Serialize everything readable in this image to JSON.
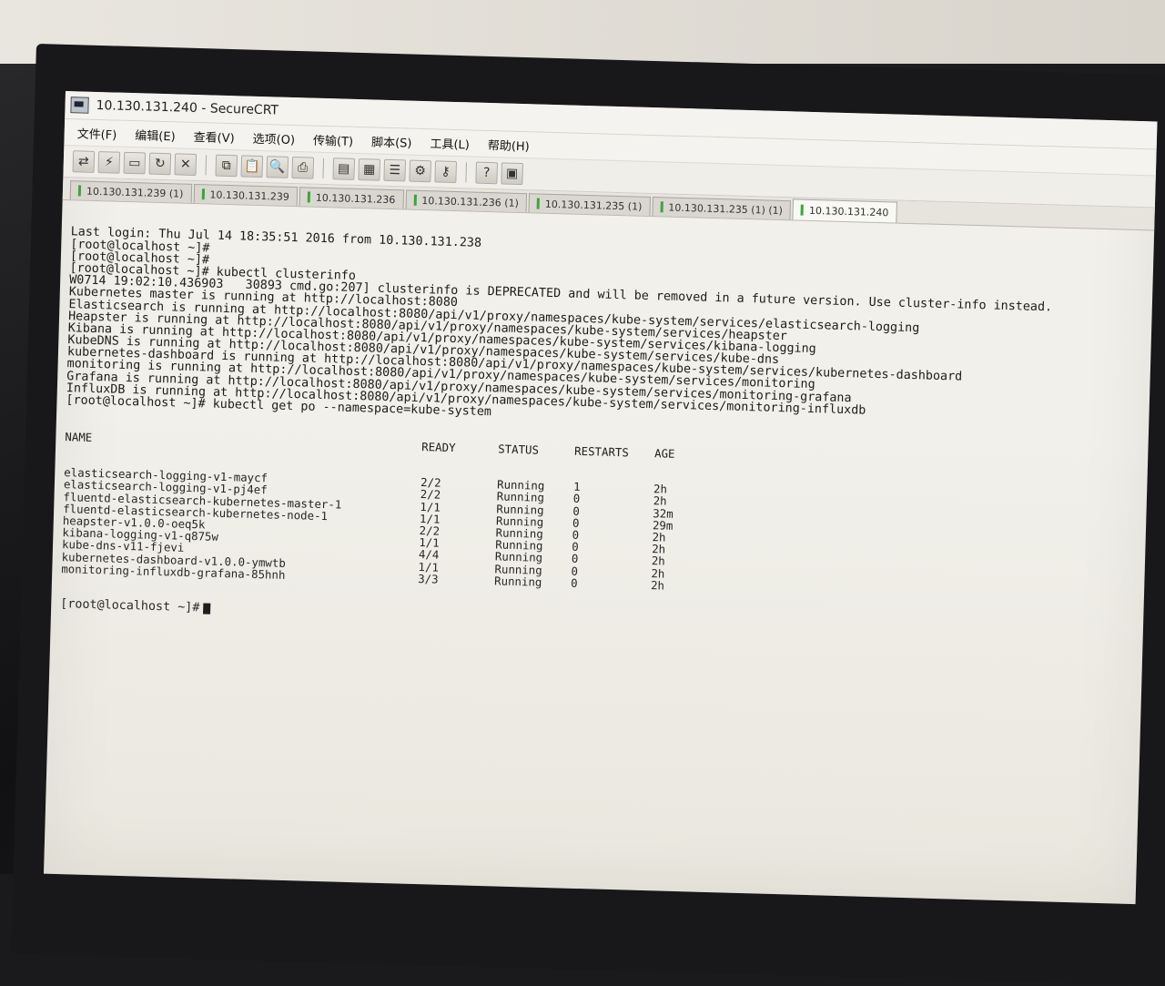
{
  "window": {
    "title": "10.130.131.240 - SecureCRT"
  },
  "menu": [
    {
      "label": "文件(F)"
    },
    {
      "label": "编辑(E)"
    },
    {
      "label": "查看(V)"
    },
    {
      "label": "选项(O)"
    },
    {
      "label": "传输(T)"
    },
    {
      "label": "脚本(S)"
    },
    {
      "label": "工具(L)"
    },
    {
      "label": "帮助(H)"
    }
  ],
  "toolbar": [
    {
      "icon": "connect-icon",
      "glyph": "⇄"
    },
    {
      "icon": "quick-connect-icon",
      "glyph": "⚡"
    },
    {
      "icon": "connect-tab-icon",
      "glyph": "▭"
    },
    {
      "icon": "reconnect-icon",
      "glyph": "↻"
    },
    {
      "icon": "disconnect-icon",
      "glyph": "✕"
    },
    {
      "icon": "copy-icon",
      "glyph": "⧉"
    },
    {
      "icon": "paste-icon",
      "glyph": "📋"
    },
    {
      "icon": "find-icon",
      "glyph": "🔍"
    },
    {
      "icon": "print-icon",
      "glyph": "⎙"
    },
    {
      "icon": "log-icon",
      "glyph": "▤"
    },
    {
      "icon": "print-screen-icon",
      "glyph": "▦"
    },
    {
      "icon": "session-options-icon",
      "glyph": "☰"
    },
    {
      "icon": "global-options-icon",
      "glyph": "⚙"
    },
    {
      "icon": "key-icon",
      "glyph": "⚷"
    },
    {
      "icon": "help-icon",
      "glyph": "?"
    },
    {
      "icon": "map-icon",
      "glyph": "▣"
    }
  ],
  "tabs": [
    {
      "label": "10.130.131.239 (1)",
      "active": false
    },
    {
      "label": "10.130.131.239",
      "active": false
    },
    {
      "label": "10.130.131.236",
      "active": false
    },
    {
      "label": "10.130.131.236 (1)",
      "active": false
    },
    {
      "label": "10.130.131.235 (1)",
      "active": false
    },
    {
      "label": "10.130.131.235 (1) (1)",
      "active": false
    },
    {
      "label": "10.130.131.240",
      "active": true
    }
  ],
  "terminal": {
    "lines": [
      "Last login: Thu Jul 14 18:35:51 2016 from 10.130.131.238",
      "[root@localhost ~]#",
      "[root@localhost ~]#",
      "[root@localhost ~]# kubectl clusterinfo",
      "W0714 19:02:10.436903   30893 cmd.go:207] clusterinfo is DEPRECATED and will be removed in a future version. Use cluster-info instead.",
      "Kubernetes master is running at http://localhost:8080",
      "Elasticsearch is running at http://localhost:8080/api/v1/proxy/namespaces/kube-system/services/elasticsearch-logging",
      "Heapster is running at http://localhost:8080/api/v1/proxy/namespaces/kube-system/services/heapster",
      "Kibana is running at http://localhost:8080/api/v1/proxy/namespaces/kube-system/services/kibana-logging",
      "KubeDNS is running at http://localhost:8080/api/v1/proxy/namespaces/kube-system/services/kube-dns",
      "kubernetes-dashboard is running at http://localhost:8080/api/v1/proxy/namespaces/kube-system/services/kubernetes-dashboard",
      "monitoring is running at http://localhost:8080/api/v1/proxy/namespaces/kube-system/services/monitoring",
      "Grafana is running at http://localhost:8080/api/v1/proxy/namespaces/kube-system/services/monitoring-grafana",
      "InfluxDB is running at http://localhost:8080/api/v1/proxy/namespaces/kube-system/services/monitoring-influxdb",
      "[root@localhost ~]# kubectl get po --namespace=kube-system"
    ],
    "pods_header": [
      "NAME",
      "READY",
      "STATUS",
      "RESTARTS",
      "AGE"
    ],
    "pods": [
      [
        "elasticsearch-logging-v1-maycf",
        "2/2",
        "Running",
        "1",
        "2h"
      ],
      [
        "elasticsearch-logging-v1-pj4ef",
        "2/2",
        "Running",
        "0",
        "2h"
      ],
      [
        "fluentd-elasticsearch-kubernetes-master-1",
        "1/1",
        "Running",
        "0",
        "32m"
      ],
      [
        "fluentd-elasticsearch-kubernetes-node-1",
        "1/1",
        "Running",
        "0",
        "29m"
      ],
      [
        "heapster-v1.0.0-oeq5k",
        "2/2",
        "Running",
        "0",
        "2h"
      ],
      [
        "kibana-logging-v1-q875w",
        "1/1",
        "Running",
        "0",
        "2h"
      ],
      [
        "kube-dns-v11-fjevi",
        "4/4",
        "Running",
        "0",
        "2h"
      ],
      [
        "kubernetes-dashboard-v1.0.0-ymwtb",
        "1/1",
        "Running",
        "0",
        "2h"
      ],
      [
        "monitoring-influxdb-grafana-85hnh",
        "3/3",
        "Running",
        "0",
        "2h"
      ]
    ],
    "prompt": "[root@localhost ~]#"
  }
}
